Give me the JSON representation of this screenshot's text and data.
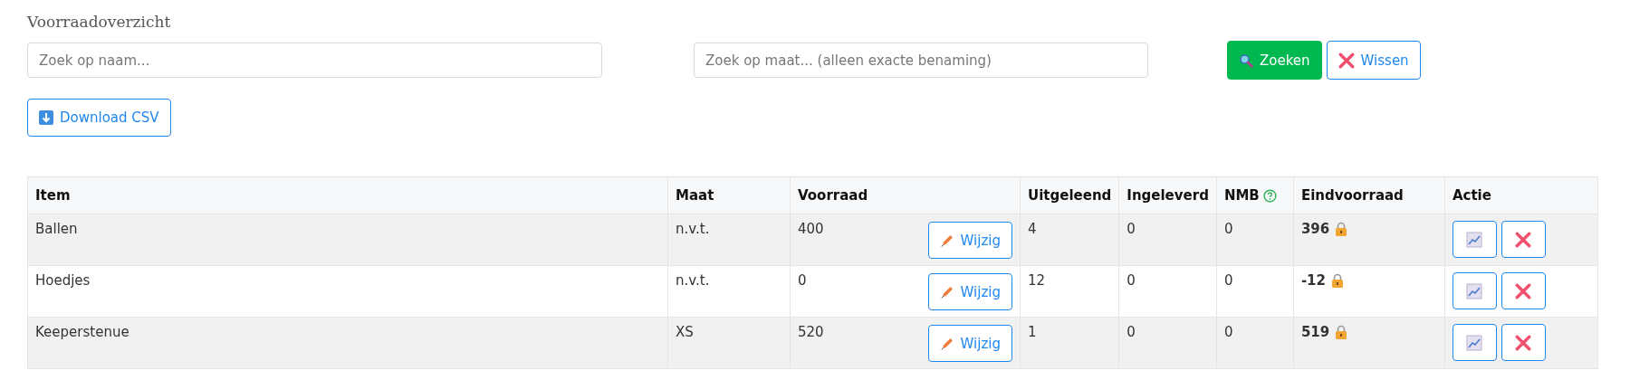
{
  "title": "Voorraadoverzicht",
  "search": {
    "name_placeholder": "Zoek op naam...",
    "size_placeholder": "Zoek op maat... (alleen exacte benaming)",
    "search_button": "Zoeken",
    "clear_button": "Wissen"
  },
  "download_button": "Download CSV",
  "table": {
    "columns": [
      "Item",
      "Maat",
      "Voorraad",
      "Uitgeleend",
      "Ingeleverd",
      "NMB",
      "Eindvoorraad",
      "Actie"
    ],
    "rows": [
      {
        "item": "Ballen",
        "maat": "n.v.t.",
        "voorraad": "400",
        "edit_label": "Wijzig",
        "uitgeleend": "4",
        "ingeleverd": "0",
        "nmb": "0",
        "eindvoorraad": "396"
      },
      {
        "item": "Hoedjes",
        "maat": "n.v.t.",
        "voorraad": "0",
        "edit_label": "Wijzig",
        "uitgeleend": "12",
        "ingeleverd": "0",
        "nmb": "0",
        "eindvoorraad": "-12"
      },
      {
        "item": "Keeperstenue",
        "maat": "XS",
        "voorraad": "520",
        "edit_label": "Wijzig",
        "uitgeleend": "1",
        "ingeleverd": "0",
        "nmb": "0",
        "eindvoorraad": "519"
      }
    ]
  }
}
